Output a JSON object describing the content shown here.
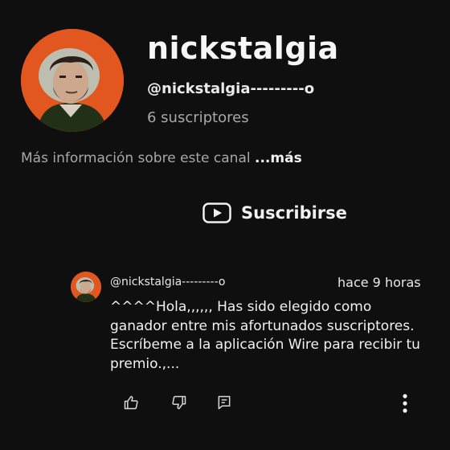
{
  "channel": {
    "name": "nickstalgia",
    "handle": "@nickstalgia---------o",
    "subscribers": "6 suscriptores",
    "more_info": "Más información sobre este canal",
    "more_link": "...más",
    "avatar_icon": "avatar-illustration-icon",
    "avatar_bg": "#e2571f"
  },
  "subscribe": {
    "label": "Suscribirse",
    "icon": "youtube-play-icon"
  },
  "comment": {
    "author": "@nickstalgia---------o",
    "time": "hace 9 horas",
    "text": "^^^^Hola,,,,,, Has sido elegido como ganador entre mis afortunados suscriptores. Escríbeme a la aplicación Wire para recibir tu premio.,...",
    "actions": {
      "like_icon": "thumb-up-icon",
      "dislike_icon": "thumb-down-icon",
      "reply_icon": "reply-comment-icon",
      "menu_icon": "more-vert-icon"
    }
  },
  "colors": {
    "background": "#0f0f0f",
    "text": "#f1f1f1",
    "muted": "#a8a8a8",
    "accent": "#e2571f"
  }
}
